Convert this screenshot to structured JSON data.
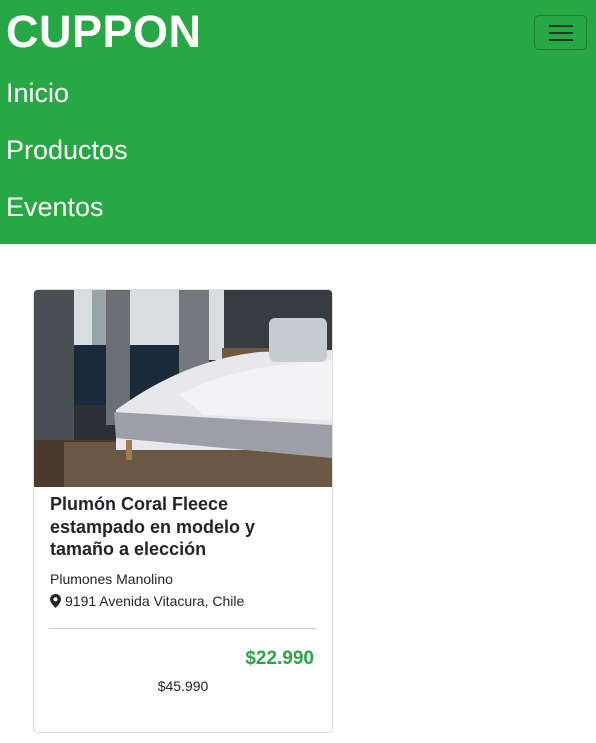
{
  "brand": "CUPPON",
  "nav": {
    "items": [
      "Inicio",
      "Productos",
      "Eventos"
    ]
  },
  "colors": {
    "navbar": "#28a745",
    "price": "#28a745"
  },
  "product": {
    "image": "bedroom-bed-photo",
    "title": "Plumón Coral Fleece estampado en modelo y tamaño a elección",
    "merchant": "Plumones Manolino",
    "address": "9191 Avenida Vitacura, Chile",
    "address_icon": "map-marker-icon",
    "price": "$22.990",
    "old_price": "$45.990"
  }
}
